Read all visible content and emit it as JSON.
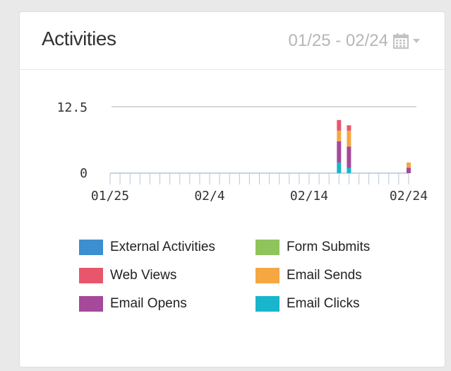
{
  "widget": {
    "title": "Activities",
    "date_range": "01/25 - 02/24",
    "calendar_icon": "calendar-icon",
    "dropdown_icon": "caret-down-icon"
  },
  "legend": [
    {
      "label": "External Activities",
      "color": "#3c8fd0"
    },
    {
      "label": "Form Submits",
      "color": "#8ec45b"
    },
    {
      "label": "Web Views",
      "color": "#e8566b"
    },
    {
      "label": "Email Sends",
      "color": "#f5a742"
    },
    {
      "label": "Email Opens",
      "color": "#a5499a"
    },
    {
      "label": "Email Clicks",
      "color": "#18b5cc"
    }
  ],
  "chart_data": {
    "type": "bar",
    "stacked": true,
    "x_tick_labels": [
      "01/25",
      "02/4",
      "02/14",
      "02/24"
    ],
    "x_tick_positions": [
      0,
      10,
      20,
      30
    ],
    "y_tick_labels": [
      "0",
      "12.5"
    ],
    "ylim": [
      0,
      12.5
    ],
    "gridlines": [
      12.5
    ],
    "categories": [
      "02/17",
      "02/18",
      "02/24"
    ],
    "category_positions": [
      23,
      24,
      30
    ],
    "series": [
      {
        "name": "Email Clicks",
        "color": "#18b5cc",
        "values": [
          2,
          1,
          0
        ]
      },
      {
        "name": "Email Opens",
        "color": "#a5499a",
        "values": [
          4,
          4,
          1
        ]
      },
      {
        "name": "Email Sends",
        "color": "#f5a742",
        "values": [
          2,
          3,
          1
        ]
      },
      {
        "name": "Web Views",
        "color": "#e8566b",
        "values": [
          2,
          1,
          0
        ]
      }
    ]
  }
}
